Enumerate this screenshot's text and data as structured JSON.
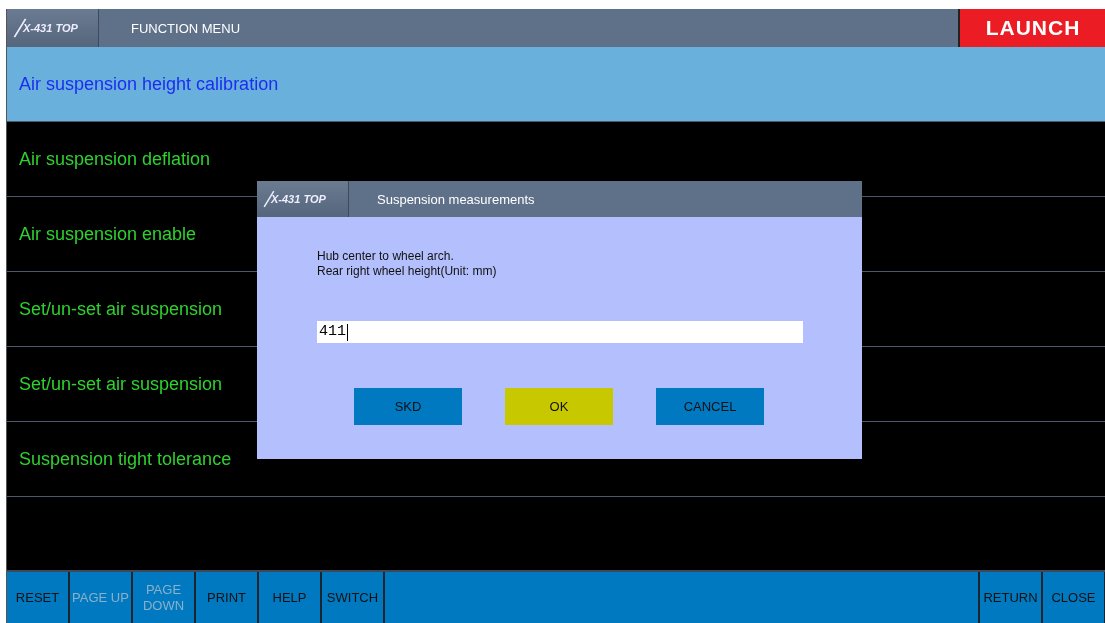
{
  "header": {
    "logo": "X-431 TOP",
    "title": "FUNCTION MENU",
    "brand": "LAUNCH"
  },
  "menu_items": [
    {
      "label": "Air suspension height calibration",
      "selected": true
    },
    {
      "label": "Air suspension deflation",
      "selected": false
    },
    {
      "label": "Air suspension enable",
      "selected": false
    },
    {
      "label": "Set/un-set air suspension",
      "selected": false
    },
    {
      "label": "Set/un-set air suspension",
      "selected": false
    },
    {
      "label": "Suspension tight tolerance",
      "selected": false
    }
  ],
  "dialog": {
    "logo": "X-431 TOP",
    "title": "Suspension measurements",
    "message_lines": [
      "Hub center to wheel arch.",
      "Rear right wheel height(Unit: mm)"
    ],
    "input": {
      "value": "411"
    },
    "buttons": [
      {
        "label": "SKD",
        "selected": false
      },
      {
        "label": "OK",
        "selected": true
      },
      {
        "label": "CANCEL",
        "selected": false
      }
    ]
  },
  "toolbar_left": [
    {
      "label": "RESET",
      "disabled": false
    },
    {
      "label": "PAGE UP",
      "disabled": true
    },
    {
      "label": "PAGE DOWN",
      "disabled": true
    },
    {
      "label": "PRINT",
      "disabled": false
    },
    {
      "label": "HELP",
      "disabled": false
    },
    {
      "label": "SWITCH",
      "disabled": false
    }
  ],
  "toolbar_right": [
    {
      "label": "RETURN",
      "disabled": false
    },
    {
      "label": "CLOSE",
      "disabled": false
    }
  ]
}
